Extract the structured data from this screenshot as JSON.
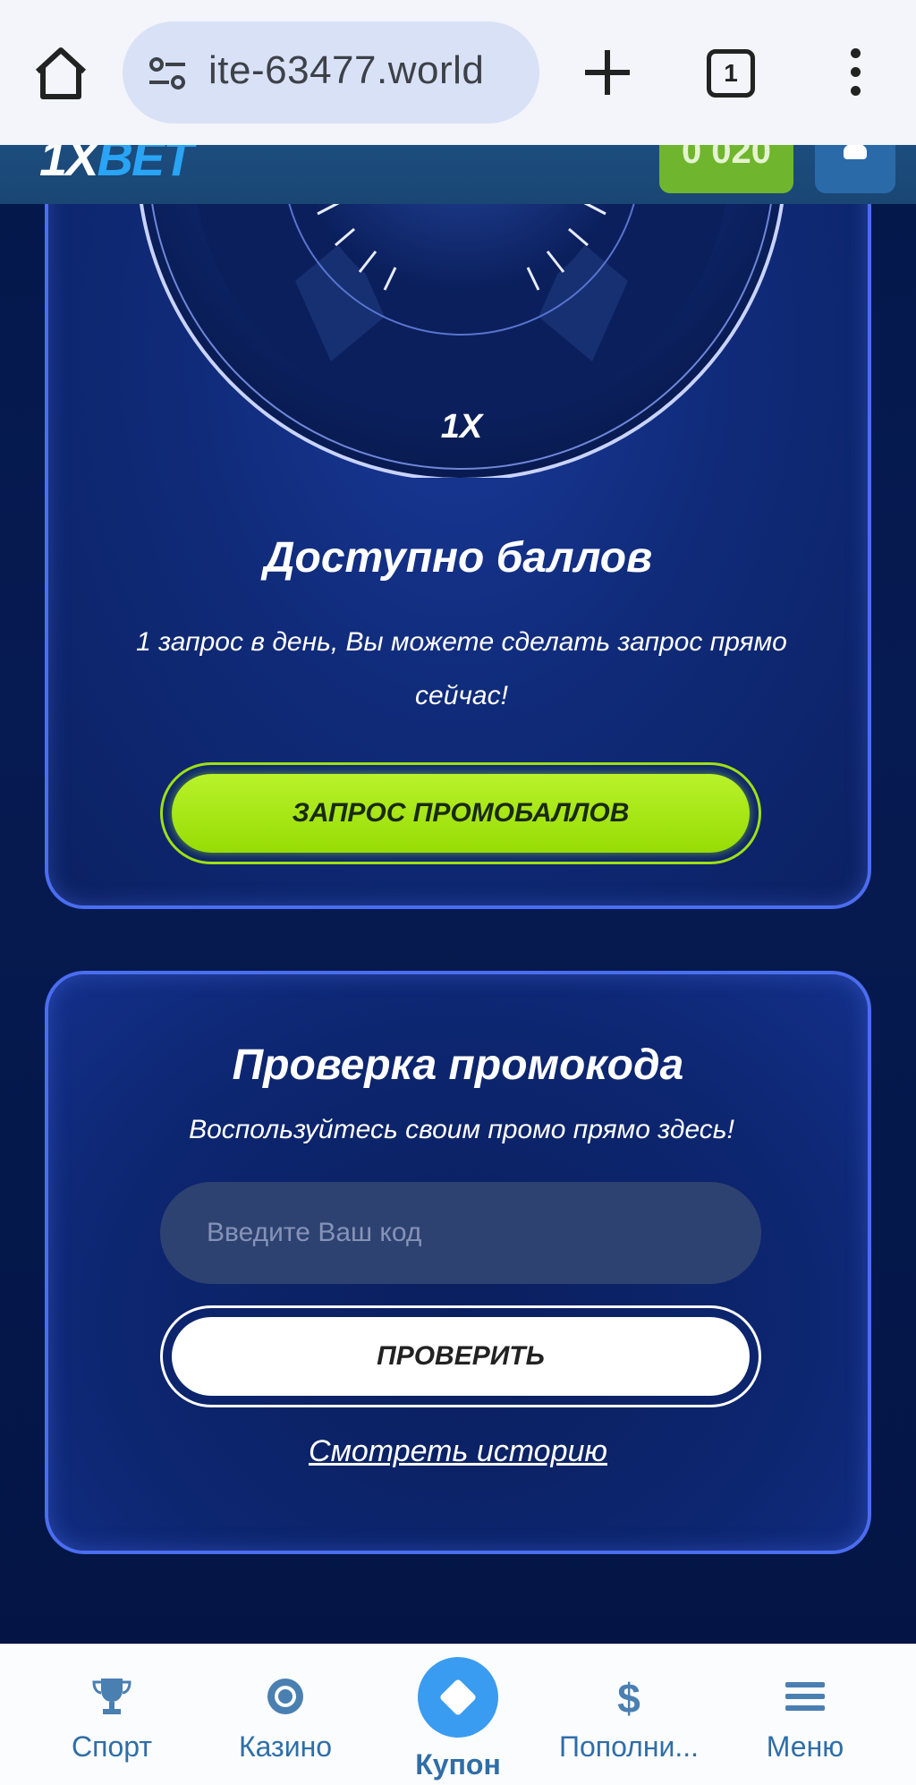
{
  "browser": {
    "url": "ite-63477.world",
    "tab_count": "1"
  },
  "header": {
    "logo_main": "1X",
    "logo_accent": "BET",
    "balance": "0 020"
  },
  "points_card": {
    "dial_logo": "1X",
    "title": "Доступно баллов",
    "subtitle": "1 запрос в день, Вы можете сделать запрос прямо сейчас!",
    "request_button": "ЗАПРОС ПРОМОБАЛЛОВ"
  },
  "promo_card": {
    "title": "Проверка промокода",
    "subtitle": "Воспользуйтесь своим промо прямо здесь!",
    "input_placeholder": "Введите Ваш код",
    "check_button": "ПРОВЕРИТЬ",
    "history_link": "Смотреть историю"
  },
  "bottom_nav": {
    "sport": "Спорт",
    "casino": "Казино",
    "coupon": "Купон",
    "deposit": "Пополни...",
    "menu": "Меню"
  },
  "colors": {
    "accent_green": "#9ee012",
    "card_border": "#4b6df0",
    "nav_blue": "#2f6ea7"
  }
}
